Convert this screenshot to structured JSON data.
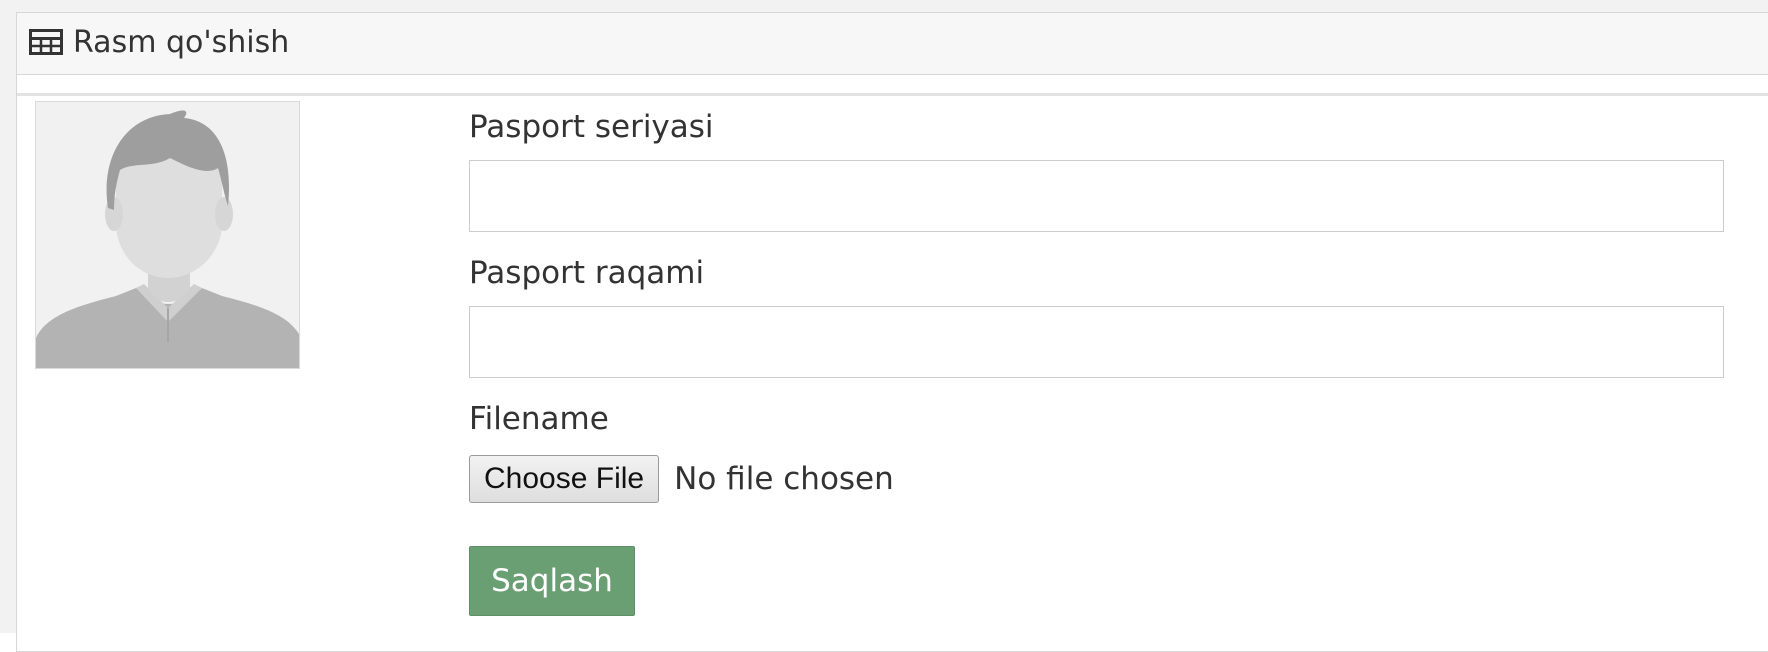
{
  "panel": {
    "title": "Rasm qo'shish",
    "title_icon": "table-icon"
  },
  "avatar": {
    "icon": "default-user-avatar"
  },
  "form": {
    "passport_series": {
      "label": "Pasport seriyasi",
      "value": "",
      "placeholder": ""
    },
    "passport_number": {
      "label": "Pasport raqami",
      "value": "",
      "placeholder": ""
    },
    "file": {
      "label": "Filename",
      "button_label": "Choose File",
      "status": "No file chosen"
    },
    "submit_label": "Saqlash"
  },
  "colors": {
    "submit_background": "#6a9f73",
    "panel_heading_background": "#f7f7f7",
    "panel_border": "#d7d7d7"
  }
}
